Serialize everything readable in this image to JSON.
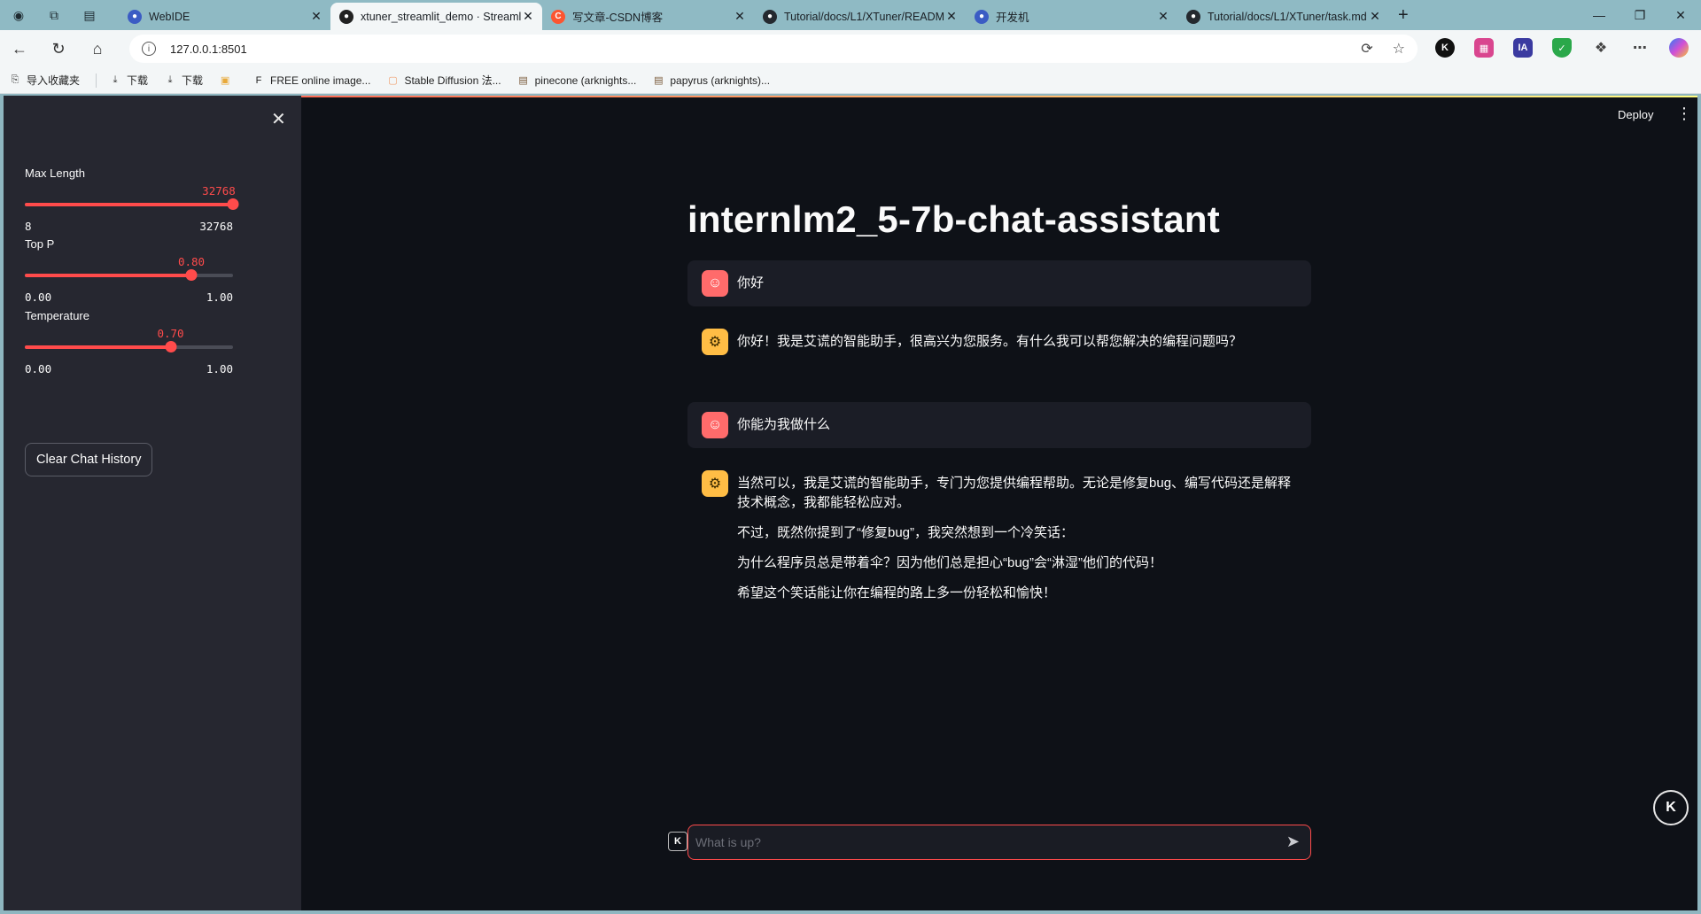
{
  "browser": {
    "tabs": [
      {
        "title": "WebIDE",
        "favicon_color": "#3b5cc4",
        "favicon_char": "●",
        "active": false
      },
      {
        "title": "xtuner_streamlit_demo · Streamlit",
        "favicon_color": "#222222",
        "favicon_char": "●",
        "active": true
      },
      {
        "title": "写文章-CSDN博客",
        "favicon_color": "#fc5531",
        "favicon_char": "C",
        "active": false
      },
      {
        "title": "Tutorial/docs/L1/XTuner/READMI",
        "favicon_color": "#24292f",
        "favicon_char": "●",
        "active": false
      },
      {
        "title": "开发机",
        "favicon_color": "#3b5cc4",
        "favicon_char": "●",
        "active": false
      },
      {
        "title": "Tutorial/docs/L1/XTuner/task.md",
        "favicon_color": "#24292f",
        "favicon_char": "●",
        "active": false
      }
    ],
    "url": "127.0.0.1:8501",
    "bookmarks": [
      {
        "label": "导入收藏夹",
        "icon": "import-icon"
      },
      {
        "label": "下载",
        "icon": "download-icon"
      },
      {
        "label": "下载",
        "icon": "download-icon"
      },
      {
        "label": "",
        "icon": "folder-icon"
      },
      {
        "label": "FREE online image...",
        "icon": "fa-icon"
      },
      {
        "label": "Stable Diffusion 法...",
        "icon": "sd-icon"
      },
      {
        "label": "pinecone (arknights...",
        "icon": "bookmark-icon"
      },
      {
        "label": "papyrus (arknights)...",
        "icon": "bookmark-icon"
      }
    ]
  },
  "sidebar": {
    "sliders": [
      {
        "label": "Max Length",
        "value": 32768,
        "value_text": "32768",
        "min": 8,
        "max": 32768,
        "min_text": "8",
        "max_text": "32768"
      },
      {
        "label": "Top P",
        "value": 0.8,
        "value_text": "0.80",
        "min": 0,
        "max": 1,
        "min_text": "0.00",
        "max_text": "1.00"
      },
      {
        "label": "Temperature",
        "value": 0.7,
        "value_text": "0.70",
        "min": 0,
        "max": 1,
        "min_text": "0.00",
        "max_text": "1.00"
      }
    ],
    "clear_button": "Clear Chat History"
  },
  "header": {
    "deploy": "Deploy"
  },
  "main": {
    "title": "internlm2_5-7b-chat-assistant",
    "messages": [
      {
        "role": "user",
        "paragraphs": [
          "你好"
        ]
      },
      {
        "role": "assistant",
        "paragraphs": [
          "你好！我是艾谎的智能助手，很高兴为您服务。有什么我可以帮您解决的编程问题吗？"
        ]
      },
      {
        "role": "user",
        "paragraphs": [
          "你能为我做什么"
        ]
      },
      {
        "role": "assistant",
        "paragraphs": [
          "当然可以，我是艾谎的智能助手，专门为您提供编程帮助。无论是修复bug、编写代码还是解释技术概念，我都能轻松应对。",
          "不过，既然你提到了“修复bug”，我突然想到一个冷笑话：",
          "为什么程序员总是带着伞？因为他们总是担心“bug”会“淋湿”他们的代码！",
          "希望这个笑话能让你在编程的路上多一份轻松和愉快！"
        ]
      }
    ],
    "chat_input_placeholder": "What is up?"
  },
  "colors": {
    "accent": "#ff4b4b",
    "user_avatar": "#ff6b6b",
    "bot_avatar": "#ffbd45"
  }
}
